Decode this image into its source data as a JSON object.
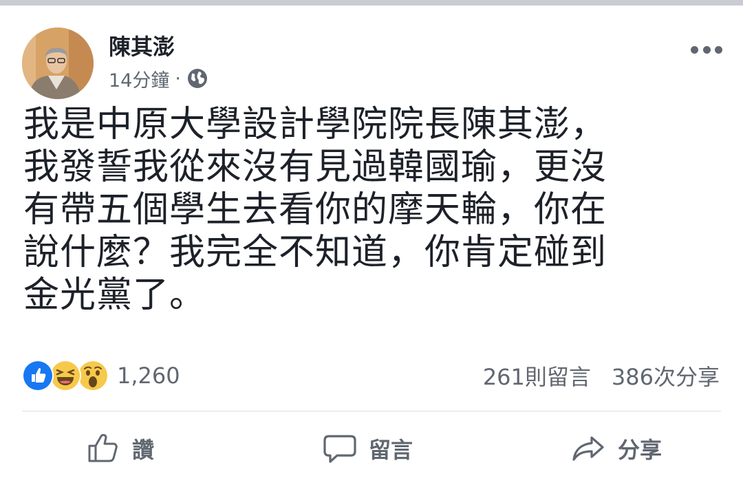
{
  "post": {
    "author": "陳其澎",
    "timestamp": "14分鐘",
    "separator": "·",
    "privacy_icon": "globe-icon",
    "menu_icon": "more-icon",
    "text_lines": [
      "我是中原大學設計學院院長陳其澎，",
      "我發誓我從來沒有見過韓國瑜，更沒",
      "有帶五個學生去看你的摩天輪，你在",
      "說什麼？我完全不知道，你肯定碰到",
      "金光黨了。"
    ]
  },
  "reactions": {
    "icons": [
      "like-icon",
      "haha-icon",
      "wow-icon"
    ],
    "count": "1,260"
  },
  "stats": {
    "comments": "261則留言",
    "shares": "386次分享"
  },
  "actions": {
    "like_label": "讚",
    "comment_label": "留言",
    "share_label": "分享"
  },
  "colors": {
    "like_blue": "#1877f2",
    "emoji_yellow": "#f7c94b",
    "text_gray": "#606770"
  }
}
